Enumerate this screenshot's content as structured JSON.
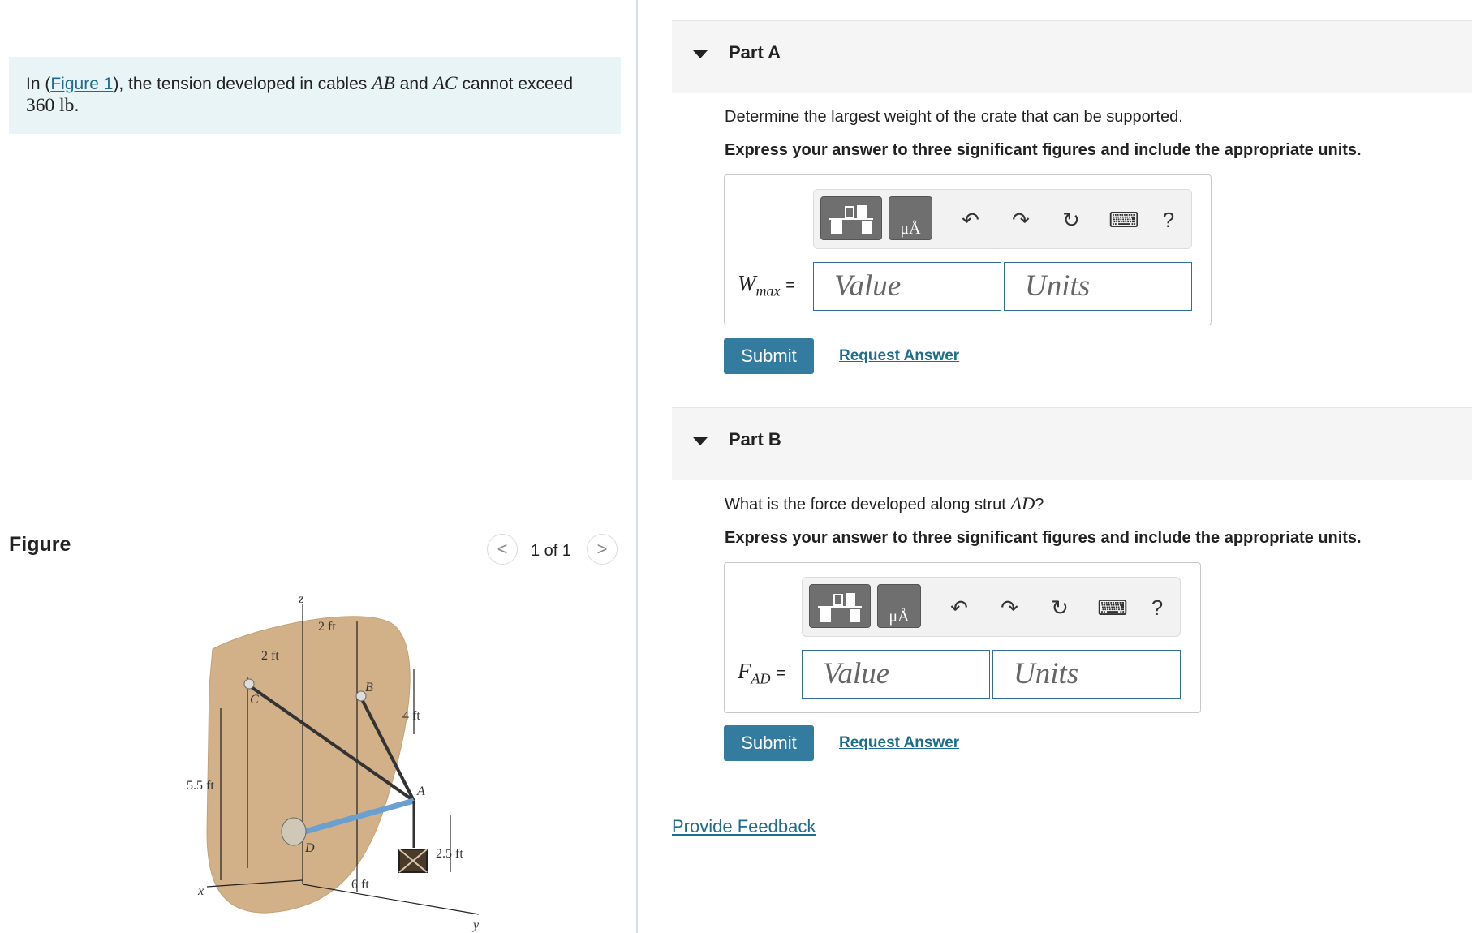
{
  "problem": {
    "prefix": "In (",
    "figure_link": "Figure 1",
    "mid1": "), the tension developed in cables ",
    "cable1": "AB",
    "and": " and ",
    "cable2": "AC",
    "mid2": " cannot exceed",
    "limit": "360 lb."
  },
  "figure": {
    "title": "Figure",
    "pager": "1 of 1",
    "prev_icon": "<",
    "next_icon": ">",
    "labels": {
      "z": "z",
      "x": "x",
      "y": "y",
      "B": "B",
      "C": "C",
      "D": "D",
      "A": "A",
      "dim_2ft_a": "2 ft",
      "dim_2ft_b": "2 ft",
      "dim_4ft": "4 ft",
      "dim_5_5ft": "5.5 ft",
      "dim_2_5ft": "2.5 ft",
      "dim_6ft": "6 ft"
    }
  },
  "parts": [
    {
      "title": "Part A",
      "question": "Determine the largest weight of the crate that can be supported.",
      "instruction": "Express your answer to three significant figures and include the appropriate units.",
      "var_main": "W",
      "var_sub": "max",
      "equals": "=",
      "value_placeholder": "Value",
      "units_placeholder": "Units",
      "submit": "Submit",
      "request": "Request Answer"
    },
    {
      "title": "Part B",
      "question_prefix": "What is the force developed along strut ",
      "question_var": "AD",
      "question_suffix": "?",
      "instruction": "Express your answer to three significant figures and include the appropriate units.",
      "var_main": "F",
      "var_sub": "AD",
      "equals": "=",
      "value_placeholder": "Value",
      "units_placeholder": "Units",
      "submit": "Submit",
      "request": "Request Answer"
    }
  ],
  "toolbar": {
    "templates_icon": "templates-icon",
    "units_glyph": "μÅ",
    "undo_icon": "↶",
    "redo_icon": "↷",
    "reset_icon": "↻",
    "keyboard_icon": "⌨",
    "help_label": "?"
  },
  "feedback": "Provide Feedback"
}
